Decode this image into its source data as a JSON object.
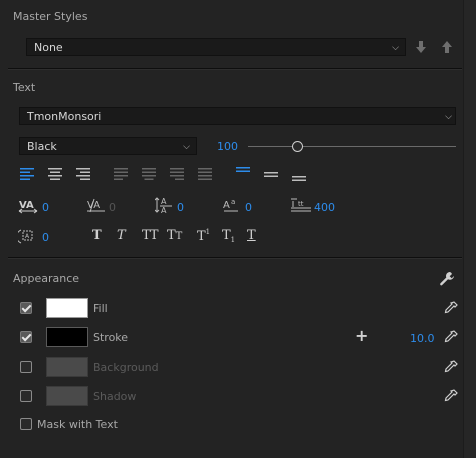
{
  "master_styles": {
    "title": "Master Styles",
    "selected": "None"
  },
  "text_section": {
    "title": "Text",
    "font_family": "TmonMonsori",
    "font_style": "Black",
    "font_size": "100",
    "font_size_fraction": 0.3,
    "kerning": "0",
    "tracking": "0",
    "baseline_shift": "0",
    "tsume": "0",
    "leading": "400",
    "rotation": "0"
  },
  "appearance": {
    "title": "Appearance",
    "fill_label": "Fill",
    "stroke_label": "Stroke",
    "stroke_width": "10.0",
    "background_label": "Background",
    "shadow_label": "Shadow",
    "mask_label": "Mask with Text",
    "fill_color": "#ffffff",
    "stroke_color": "#000000",
    "fill_checked": true,
    "stroke_checked": true,
    "background_checked": false,
    "shadow_checked": false,
    "mask_checked": false
  },
  "colors": {
    "accent": "#2d8ceb"
  }
}
